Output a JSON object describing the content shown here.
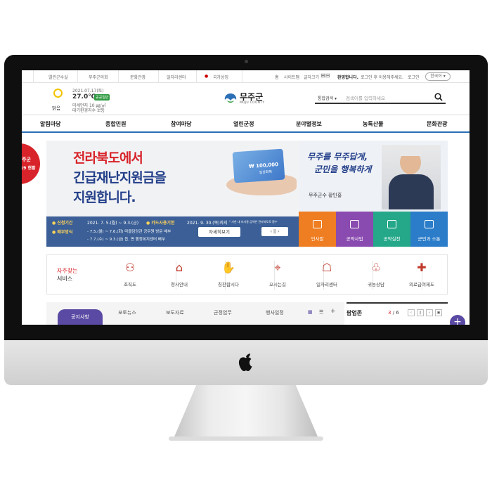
{
  "util": {
    "items": [
      "열린군수실",
      "무주군의회",
      "문화관광",
      "일자리센터",
      "국가상징"
    ],
    "right": [
      "홈",
      "사이트맵",
      "글자크기"
    ],
    "notice": "환영합니다.",
    "login_msg": "로그인 후 이용해주세요.",
    "login": "로그인",
    "lang": "한국어 ▾"
  },
  "weather": {
    "date": "2021.07.17(토)",
    "temp": "27.0℃",
    "badge": "공공일반",
    "cond": "맑음",
    "dust": "미세먼지 10 ㎍/㎥",
    "air": "대기환경지수 보통"
  },
  "logo": {
    "name": "무주군",
    "sub": "MUJU COUNTY"
  },
  "search": {
    "label": "통합검색 ▾",
    "placeholder": "검색어를 입력하세요"
  },
  "nav": [
    "알림마당",
    "종합민원",
    "참여마당",
    "열린군정",
    "분야별정보",
    "농특산물",
    "문화관광"
  ],
  "hero": {
    "line1": "전라북도에서",
    "line2": "긴급재난지원금을",
    "line3": "지원합니다.",
    "card_amount": "₩ 100,000",
    "card_sub": "일상회복",
    "apply_label": "● 신청기간",
    "apply_period": "2021. 7. 5.(월) ~ 9.3.(금)",
    "card_label": "● 카드사용기한",
    "card_period": "2021. 9. 30.(목)까지",
    "card_note": "* 기한 내 미사용 금액은 전라북도로 환수",
    "dist_label": "● 배부방식",
    "dist1": "- 7.5.(월) ~ 7.6.(화) 마을담당관 공무원 방문 배부",
    "dist2": "- 7.7.(수) ~ 9.3.(금) 읍, 면 행정복지센터 배부",
    "detail": "자세히보기",
    "ctrl": "‹  ||  ›"
  },
  "side_banner": {
    "line1": "주군",
    "line2": "19 현황"
  },
  "mayor": {
    "slogan1": "무주를 무주답게,",
    "slogan2": "군민을 행복하게",
    "name": "무주군수  황인홍",
    "tiles": [
      {
        "label": "인사말",
        "color": "#ef7d22"
      },
      {
        "label": "공약사업",
        "color": "#8a4bb0"
      },
      {
        "label": "공약실천",
        "color": "#25a88a"
      },
      {
        "label": "군민과 소통",
        "color": "#2b7cc9"
      }
    ]
  },
  "services": {
    "title1": "자주찾는",
    "title2": "서비스",
    "items": [
      {
        "label": "조직도",
        "icon": "org-chart-icon",
        "glyph": "⚇"
      },
      {
        "label": "청사안내",
        "icon": "building-icon",
        "glyph": "⌂"
      },
      {
        "label": "칭찬합시다",
        "icon": "hand-icon",
        "glyph": "✋"
      },
      {
        "label": "오시는길",
        "icon": "map-pin-icon",
        "glyph": "⌖"
      },
      {
        "label": "일자리센터",
        "icon": "job-icon",
        "glyph": "☖"
      },
      {
        "label": "귀농상담",
        "icon": "sprout-icon",
        "glyph": "♧"
      },
      {
        "label": "의료급여제도",
        "icon": "medical-icon",
        "glyph": "✚"
      }
    ]
  },
  "tabs": {
    "active": "공지사항",
    "items": [
      "포토뉴스",
      "보도자료",
      "군정업무",
      "행사일정"
    ]
  },
  "popup": {
    "title": "팝업존",
    "current": "3",
    "total": "/ 6"
  },
  "colors": {
    "brand_blue": "#2b6fb6",
    "accent_purple": "#5b4aa3",
    "red": "#d8232a"
  }
}
